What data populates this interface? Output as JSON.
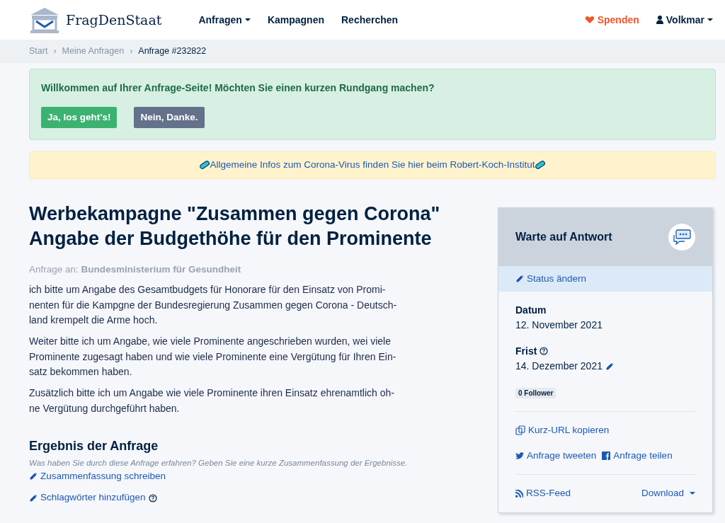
{
  "header": {
    "logo": "FragDenStaat",
    "nav": [
      {
        "label": "Anfragen",
        "dropdown": true
      },
      {
        "label": "Kampagnen",
        "dropdown": false
      },
      {
        "label": "Recherchen",
        "dropdown": false
      }
    ],
    "donate": "Spenden",
    "user": "Volkmar"
  },
  "breadcrumb": {
    "separator": "›",
    "items": [
      "Start",
      "Meine Anfragen",
      "Anfrage #232822"
    ]
  },
  "welcome": {
    "text": "Willkommen auf Ihrer Anfrage-Seite! Möchten Sie einen kurzen Rundgang machen?",
    "buttons": [
      "Ja, los geht's!",
      "Nein, Danke."
    ]
  },
  "notice": "Allgemeine Infos zum Corona-Virus finden Sie hier beim Robert-Koch-Institut",
  "request": {
    "title_lines": [
      "Werbekampagne \"Zusammen gegen Corona\"",
      "Angabe der Budgethöhe für den Prominente"
    ],
    "recipient_label": "Anfrage an:",
    "recipient": "Bundesministerium für Gesundheit",
    "paragraphs": [
      [
        "ich bitte um Angabe des Gesamtbudgets für Honorare für den Einsatz von Promi-",
        "nenten für die Kampgne der Bundesregierung Zusammen gegen Corona - Deutsch-",
        "land krempelt die Arme hoch."
      ],
      [
        "Weiter bitte ich um Angabe, wie viele Prominente angeschrieben wurden, wei viele",
        "Prominente zugesagt haben und wie viele Prominente eine Vergütung für Ihren Ein-",
        "satz bekommen haben."
      ],
      [
        "Zusätzlich bitte ich um Angabe wie viele Prominente ihren Einsatz ehrenamtlich oh-",
        "ne Vergütung durchgeführt haben."
      ]
    ]
  },
  "result": {
    "heading": "Ergebnis der Anfrage",
    "hint": "Was haben Sie durch diese Anfrage erfahren? Geben Sie eine kurze Zusammenfassung der Ergebnisse.",
    "summary_link": "Zusammenfassung schreiben",
    "tags_link": "Schlagwörter hinzufügen"
  },
  "sidebar": {
    "status": "Warte auf Antwort",
    "change_status": "Status ändern",
    "date_label": "Datum",
    "date": "12. November 2021",
    "deadline_label": "Frist",
    "deadline": "14. Dezember 2021",
    "followers": "0 Follower",
    "copy_url": "Kurz-URL kopieren",
    "tweet": "Anfrage tweeten",
    "share": "Anfrage teilen",
    "rss": "RSS-Feed",
    "download": "Download"
  }
}
